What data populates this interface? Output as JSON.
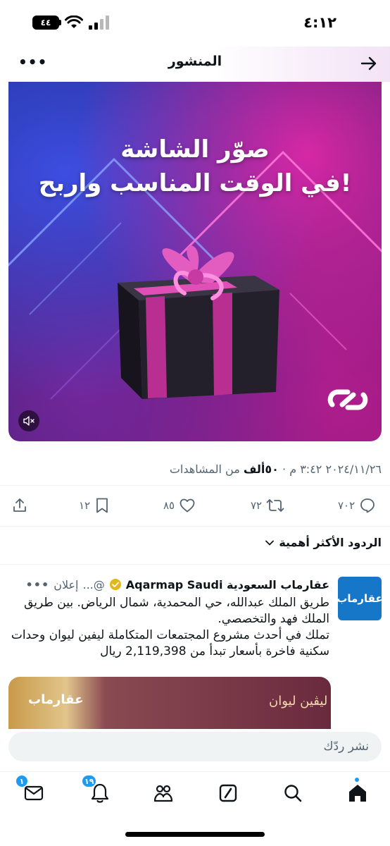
{
  "status_bar": {
    "time": "٤:١٢",
    "battery": "٤٤"
  },
  "header": {
    "title": "المنشور",
    "back_icon": "arrow-right-icon",
    "more_icon": "ellipsis-icon",
    "more_label": "•••"
  },
  "media": {
    "promo_line1": "صوّر الشاشة",
    "promo_line2": "في الوقت المناسب واربح!",
    "mute_icon": "speaker-muted-icon",
    "logo_icon": "brand-link-logo-icon"
  },
  "post_meta": {
    "time": "٣:٤٢ م",
    "date": "٢٠٢٤/١١/٢٦",
    "views_count": "٥٠ألف",
    "views_label": "من المشاهدات"
  },
  "actions": {
    "replies": "٧٠٢",
    "retweets": "٧٢",
    "likes": "٨٥",
    "bookmarks": "١٢"
  },
  "sort": {
    "label": "الردود الأكثر أهمية"
  },
  "ad": {
    "avatar_text": "عقارماب",
    "name": "عقارماب السعودية Aqarmap Saudi",
    "handle": "@...",
    "label": "إعلان",
    "more": "•••",
    "text_line1": "طريق الملك عبدالله، حي المحمدية، شمال الرياض. بين طريق الملك فهد والتخصصي.",
    "text_line2": "تملك في أحدث مشروع المجتمعات المتكاملة ليفين ليوان وحدات سكنية فاخرة بأسعار تبدأ من 2,119,398 ريال",
    "media_brand": "عقارماب",
    "media_project": "ليڤين ليوان"
  },
  "composer": {
    "placeholder": "نشر ردّك"
  },
  "bottom_nav": {
    "messages_badge": "١",
    "notifications_badge": "١٩"
  },
  "colors": {
    "accent": "#1d9bf0",
    "text": "#0f1419",
    "secondary": "#536471"
  }
}
